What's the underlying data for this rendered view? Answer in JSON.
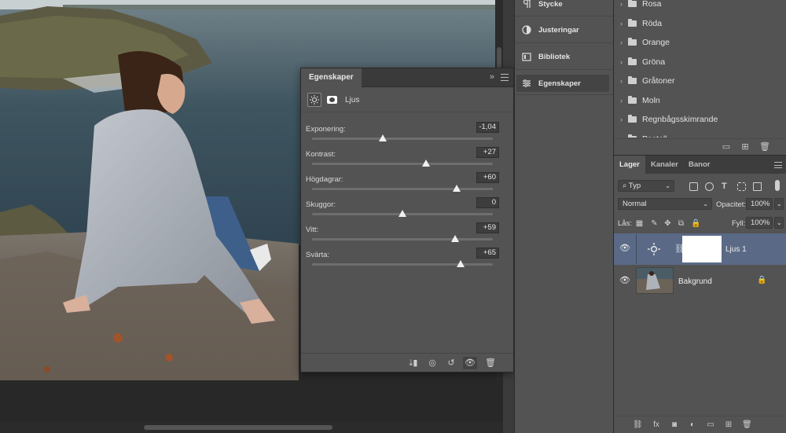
{
  "properties_panel": {
    "tab_label": "Egenskaper",
    "collapse_glyph": "»",
    "type_label": "Ljus",
    "type_icon": "brightness-icon",
    "adjustments": [
      {
        "label": "Exponering:",
        "value": "-1,04",
        "level": 0.39
      },
      {
        "label": "Kontrast:",
        "value": "+27",
        "level": 0.63
      },
      {
        "label": "Högdagrar:",
        "value": "+60",
        "level": 0.8
      },
      {
        "label": "Skuggor:",
        "value": "0",
        "level": 0.5
      },
      {
        "label": "Vitt:",
        "value": "+59",
        "level": 0.79
      },
      {
        "label": "Svärta:",
        "value": "+65",
        "level": 0.82
      }
    ]
  },
  "dock": {
    "items": [
      {
        "label": "Stycke",
        "icon": "paragraph-icon"
      },
      {
        "label": "Justeringar",
        "icon": "adjustments-icon"
      },
      {
        "label": "Bibliotek",
        "icon": "library-icon"
      },
      {
        "label": "Egenskaper",
        "icon": "properties-icon",
        "active": true
      }
    ]
  },
  "swatches": {
    "folders": [
      "Rosa",
      "Röda",
      "Orange",
      "Gröna",
      "Gråtoner",
      "Moln",
      "Regnbågsskimrande",
      "Pastell"
    ]
  },
  "layers_panel": {
    "tabs": [
      "Lager",
      "Kanaler",
      "Banor"
    ],
    "filter_kind": "Typ",
    "blend_mode": "Normal",
    "opacity_label": "Opacitet:",
    "opacity_value": "100%",
    "lock_label": "Lås:",
    "fill_label": "Fyll:",
    "fill_value": "100%",
    "layers": [
      {
        "name": "Ljus 1",
        "selected": true
      },
      {
        "name": "Bakgrund",
        "selected": false
      }
    ]
  },
  "colors": {
    "selection": "#5a6a86",
    "panel_bg": "#535353"
  }
}
